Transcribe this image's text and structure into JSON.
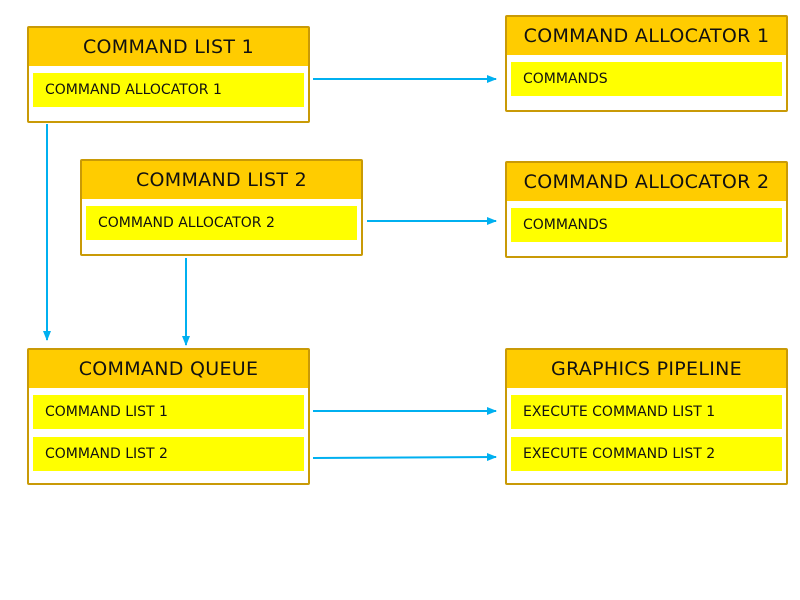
{
  "diagram": {
    "accent_color": "#00B0F0",
    "nodes": {
      "command_list_1": {
        "title": "COMMAND LIST 1",
        "items": [
          "COMMAND ALLOCATOR 1"
        ]
      },
      "command_list_2": {
        "title": "COMMAND LIST 2",
        "items": [
          "COMMAND ALLOCATOR 2"
        ]
      },
      "command_allocator_1": {
        "title": "COMMAND ALLOCATOR 1",
        "items": [
          "COMMANDS"
        ]
      },
      "command_allocator_2": {
        "title": "COMMAND ALLOCATOR 2",
        "items": [
          "COMMANDS"
        ]
      },
      "command_queue": {
        "title": "COMMAND QUEUE",
        "items": [
          "COMMAND LIST 1",
          "COMMAND LIST 2"
        ]
      },
      "graphics_pipeline": {
        "title": "GRAPHICS PIPELINE",
        "items": [
          "EXECUTE COMMAND LIST 1",
          "EXECUTE COMMAND LIST 2"
        ]
      }
    },
    "edges": [
      {
        "from": "command_list_1.items.0",
        "to": "command_allocator_1.items.0"
      },
      {
        "from": "command_list_2.items.0",
        "to": "command_allocator_2.items.0"
      },
      {
        "from": "command_list_1",
        "to": "command_queue"
      },
      {
        "from": "command_list_2",
        "to": "command_queue"
      },
      {
        "from": "command_queue.items.0",
        "to": "graphics_pipeline.items.0"
      },
      {
        "from": "command_queue.items.1",
        "to": "graphics_pipeline.items.1"
      }
    ]
  }
}
